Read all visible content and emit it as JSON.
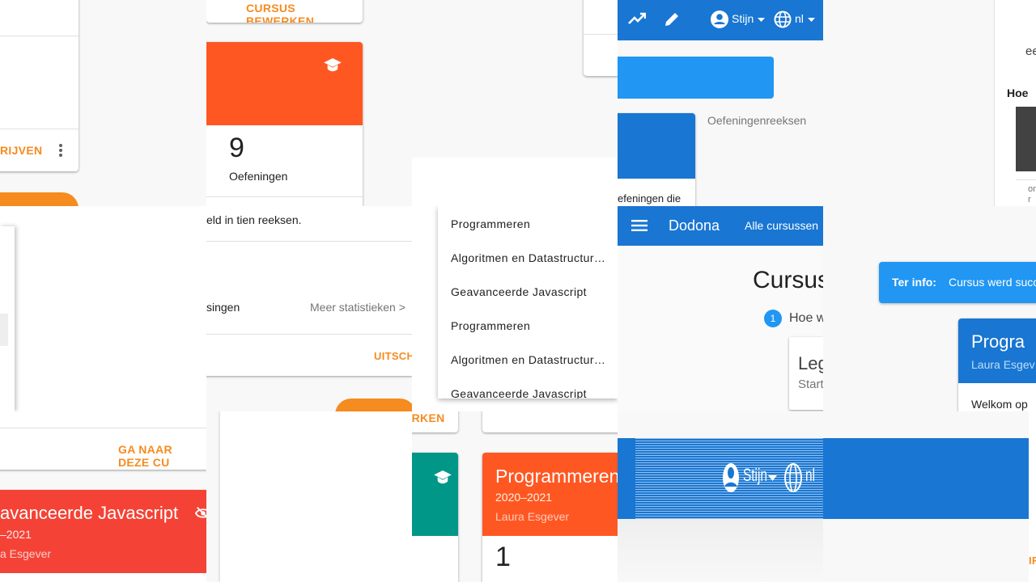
{
  "t1": {
    "action_label": "CURSUS BEWERKEN",
    "left_action": "RIJVEN",
    "count": "9",
    "count_label": "Oefeningen"
  },
  "t2": {
    "nav": {
      "user": "Stijn",
      "lang": "nl"
    },
    "section_title": "Oefeningenreeksen",
    "text_fragment": "efeningen die"
  },
  "t3": {
    "fragment": "ee",
    "heading": "Hoe",
    "side_text": "om\nr"
  },
  "t5": {
    "description_fragment": "eld in tien reeksen.",
    "stats_label_fragment": "singen",
    "more_stats": "Meer statistieken >",
    "action_fragment": "UITSCH"
  },
  "t6": {
    "menu": [
      "Programmeren",
      "Algoritmen en Datastructur…",
      "Geavanceerde Javascript",
      "Programmeren",
      "Algoritmen en Datastructur…",
      "Geavanceerde Javascript"
    ]
  },
  "t7": {
    "brand": "Dodona",
    "nav_link": "Alle cursussen",
    "heading": "Cursus",
    "step_number": "1",
    "step_text": "Hoe w",
    "card_title": "Leg",
    "card_sub": "Start"
  },
  "t8": {
    "alert_bold": "Ter info:",
    "alert_text": "Cursus werd succe",
    "card_title": "Progra",
    "card_teacher": "Laura Esgev",
    "card_text": "Welkom op"
  },
  "t9": {
    "link": "GA NAAR DEZE CU",
    "card_title": "avanceerde Javascript",
    "year": "–2021",
    "teacher": "a Esgever"
  },
  "t11": {
    "action": "ERKEN"
  },
  "t12": {
    "card_title": "Programmeren",
    "year": "2020–2021",
    "teacher": "Laura Esgever",
    "count": "1"
  },
  "t13": {
    "user": "Stijn",
    "lang": "nl"
  },
  "t14": {
    "fragment": "IR"
  },
  "colors": {
    "primary": "#1976d2",
    "orange": "#ff5722",
    "red": "#f44336",
    "teal": "#009688",
    "accent": "#f68b1f",
    "info": "#2196f3"
  }
}
